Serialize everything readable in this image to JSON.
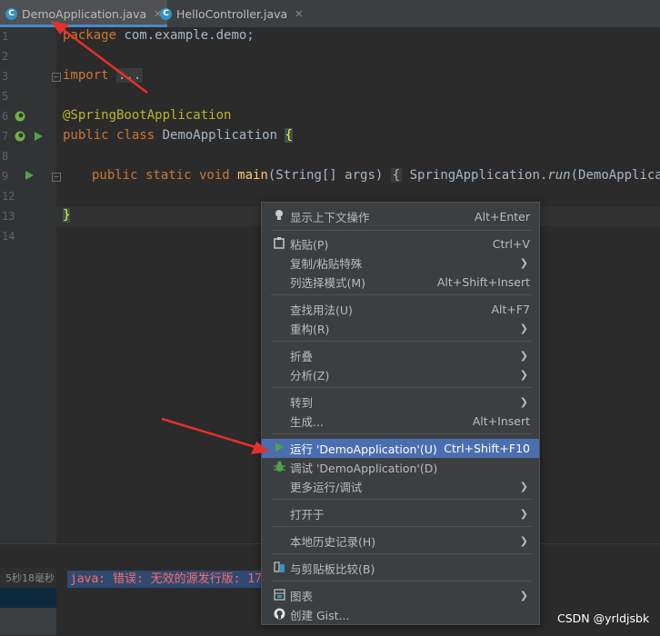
{
  "tabs": [
    {
      "label": "DemoApplication.java",
      "icon": "C",
      "active": true
    },
    {
      "label": "HelloController.java",
      "icon": "C",
      "active": false
    }
  ],
  "line_numbers": [
    "1",
    "2",
    "3",
    "5",
    "6",
    "7",
    "8",
    "9",
    "12",
    "13",
    "14"
  ],
  "code": {
    "l1_kw": "package",
    "l1_rest": " com.example.demo;",
    "l3_kw": "import",
    "l3_fold": "...",
    "l6_ann": "@SpringBootApplication",
    "l7_kw": "public class",
    "l7_name": " DemoApplication ",
    "l7_brace": "{",
    "l9_kw": "public static void",
    "l9_fn": "main",
    "l9_sig": "(String[] args) ",
    "l9_brace": "{",
    "l9_call": " SpringApplication.",
    "l9_run": "run",
    "l9_tail": "(DemoApplication",
    "l13_brace": "}"
  },
  "bottom": {
    "time": "5秒18毫秒",
    "error": "java: 错误: 无效的源发行版: 17"
  },
  "menu": {
    "items": [
      {
        "icon": "bulb-icon",
        "label": "显示上下文操作",
        "shortcut": "Alt+Enter",
        "submenu": false
      },
      {
        "icon": "clipboard-icon",
        "label": "粘贴(P)",
        "shortcut": "Ctrl+V",
        "submenu": false
      },
      {
        "icon": "",
        "label": "复制/粘贴特殊",
        "shortcut": "",
        "submenu": true
      },
      {
        "icon": "",
        "label": "列选择模式(M)",
        "shortcut": "Alt+Shift+Insert",
        "submenu": false
      },
      {
        "icon": "",
        "label": "查找用法(U)",
        "shortcut": "Alt+F7",
        "submenu": false
      },
      {
        "icon": "",
        "label": "重构(R)",
        "shortcut": "",
        "submenu": true
      },
      {
        "icon": "",
        "label": "折叠",
        "shortcut": "",
        "submenu": true
      },
      {
        "icon": "",
        "label": "分析(Z)",
        "shortcut": "",
        "submenu": true
      },
      {
        "icon": "",
        "label": "转到",
        "shortcut": "",
        "submenu": true
      },
      {
        "icon": "",
        "label": "生成...",
        "shortcut": "Alt+Insert",
        "submenu": false
      },
      {
        "icon": "run-icon",
        "label": "运行 'DemoApplication'(U)",
        "shortcut": "Ctrl+Shift+F10",
        "submenu": false,
        "selected": true
      },
      {
        "icon": "debug-icon",
        "label": "调试 'DemoApplication'(D)",
        "shortcut": "",
        "submenu": false
      },
      {
        "icon": "",
        "label": "更多运行/调试",
        "shortcut": "",
        "submenu": true
      },
      {
        "icon": "",
        "label": "打开于",
        "shortcut": "",
        "submenu": true
      },
      {
        "icon": "",
        "label": "本地历史记录(H)",
        "shortcut": "",
        "submenu": true
      },
      {
        "icon": "compare-icon",
        "label": "与剪贴板比较(B)",
        "shortcut": "",
        "submenu": false
      },
      {
        "icon": "diagram-icon",
        "label": "图表",
        "shortcut": "",
        "submenu": true
      },
      {
        "icon": "github-icon",
        "label": "创建 Gist...",
        "shortcut": "",
        "submenu": false
      }
    ]
  },
  "watermark": "CSDN @yrldjsbk",
  "colors": {
    "accent": "#4b6eaf",
    "run": "#4fa34b",
    "error": "#ff6b68",
    "arrow": "#e8302a"
  }
}
